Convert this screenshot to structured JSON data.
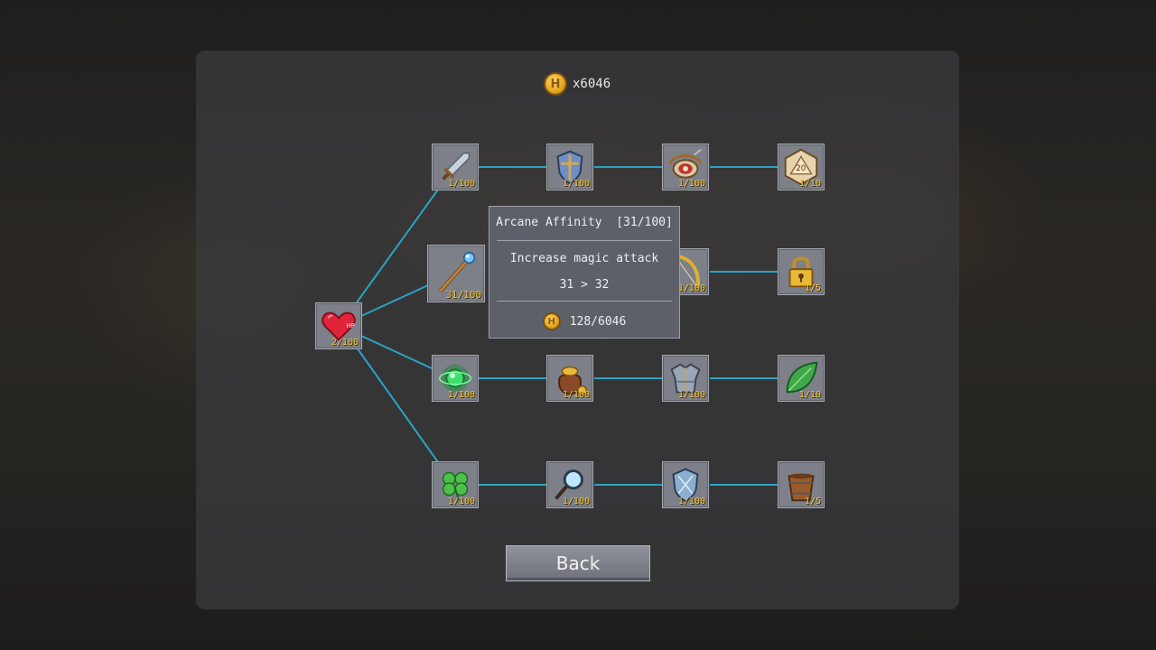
{
  "currency": {
    "icon": "coin-icon",
    "letter": "H",
    "count": "x6046"
  },
  "tooltip": {
    "title": "Arcane Affinity  [31/100]",
    "description": "Increase magic attack",
    "value_change": "31 > 32",
    "cost": "128/6046"
  },
  "nodes": {
    "hp": {
      "icon": "heart-hp-icon",
      "level": "2/100"
    },
    "r1c1": {
      "icon": "sword-icon",
      "level": "1/100"
    },
    "r1c2": {
      "icon": "shield-icon",
      "level": "1/100"
    },
    "r1c3": {
      "icon": "bow-target-icon",
      "level": "1/100"
    },
    "r1c4": {
      "icon": "d20-dice-icon",
      "level": "1/10"
    },
    "r2c1": {
      "icon": "magic-staff-icon",
      "level": "31/100"
    },
    "r2c3": {
      "icon": "golden-bow-icon",
      "level": "1/100"
    },
    "r2c4": {
      "icon": "padlock-icon",
      "level": "1/5"
    },
    "r3c1": {
      "icon": "green-orb-icon",
      "level": "1/100"
    },
    "r3c2": {
      "icon": "coin-bag-icon",
      "level": "1/100"
    },
    "r3c3": {
      "icon": "armor-icon",
      "level": "1/100"
    },
    "r3c4": {
      "icon": "leaf-icon",
      "level": "1/10"
    },
    "r4c1": {
      "icon": "clover-icon",
      "level": "1/100"
    },
    "r4c2": {
      "icon": "magnifier-icon",
      "level": "1/100"
    },
    "r4c3": {
      "icon": "crystal-shield-icon",
      "level": "1/100"
    },
    "r4c4": {
      "icon": "bucket-icon",
      "level": "1/5"
    }
  },
  "back_label": "Back",
  "colors": {
    "link": "#2aa3c4",
    "level_text": "#f3c13a",
    "node_bg": "#7d8088"
  }
}
